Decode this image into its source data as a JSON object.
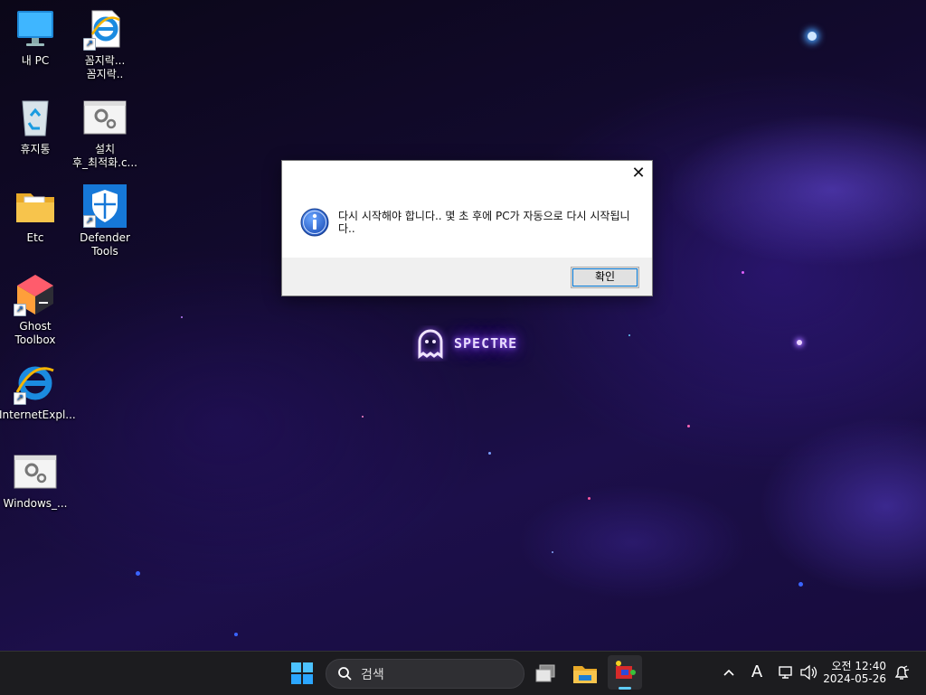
{
  "desktop": {
    "icons": [
      {
        "label": "내 PC",
        "glyph": "computer-icon",
        "shortcut": false
      },
      {
        "label": "꼼지락...\n꼼지락..",
        "glyph": "internet-explorer-icon",
        "shortcut": true
      },
      {
        "label": "휴지통",
        "glyph": "recycle-bin-icon",
        "shortcut": false
      },
      {
        "label": "설치\n후_최적화.c...",
        "glyph": "settings-script-icon",
        "shortcut": false
      },
      {
        "label": "Etc",
        "glyph": "folder-icon",
        "shortcut": false
      },
      {
        "label": "Defender\nTools",
        "glyph": "defender-shield-icon",
        "shortcut": true
      },
      {
        "label": "Ghost\nToolbox",
        "glyph": "ghost-toolbox-icon",
        "shortcut": true
      },
      {
        "label": "InternetExpl...",
        "glyph": "internet-explorer-icon",
        "shortcut": true
      },
      {
        "label": "Windows_...",
        "glyph": "settings-script-icon",
        "shortcut": false
      }
    ],
    "logo_text": "SPECTRE"
  },
  "dialog": {
    "message": "다시 시작해야 합니다.. 몇 초 후에 PC가 자동으로 다시 시작됩니다..",
    "ok_label": "확인",
    "close_glyph": "✕",
    "icon": "information-icon"
  },
  "taskbar": {
    "search_placeholder": "검색",
    "tray": {
      "input_indicator": "A",
      "time": "오전 12:40",
      "date": "2024-05-26"
    }
  },
  "colors": {
    "accent": "#0078d7",
    "taskbar_bg": "#1c1c1f",
    "active_indicator": "#60cdff"
  }
}
